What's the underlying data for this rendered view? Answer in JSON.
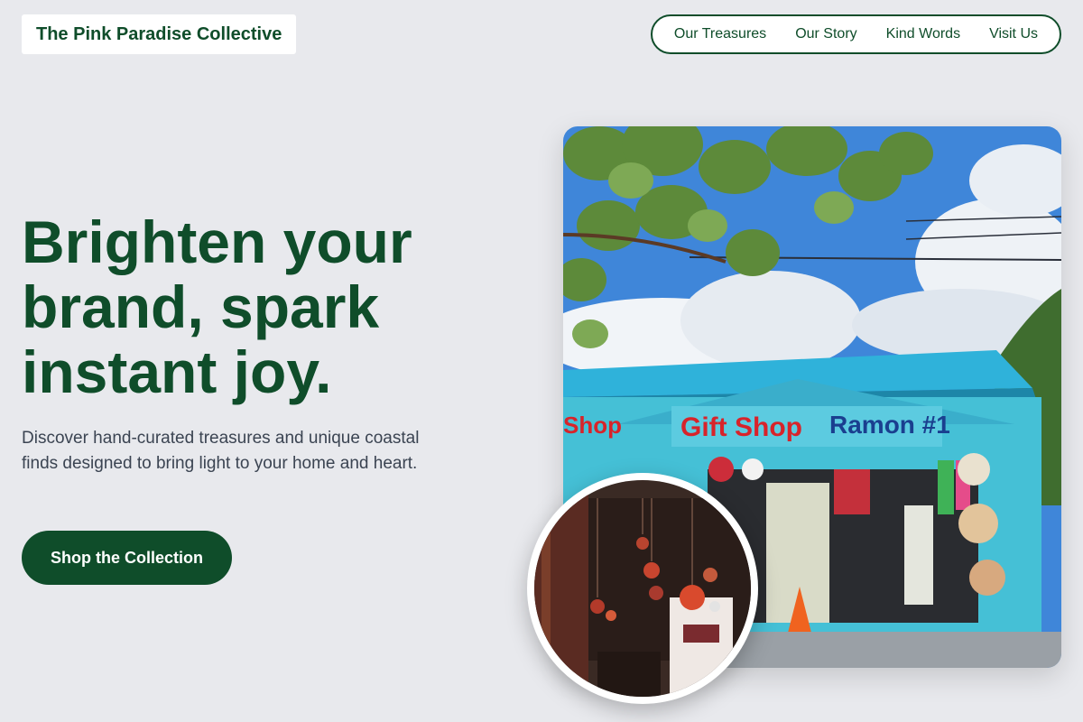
{
  "brand": {
    "name": "The Pink Paradise Collective"
  },
  "nav": {
    "items": [
      {
        "label": "Our Treasures"
      },
      {
        "label": "Our Story"
      },
      {
        "label": "Kind Words"
      },
      {
        "label": "Visit Us"
      }
    ]
  },
  "hero": {
    "headline": "Brighten your brand, spark instant joy.",
    "subtext": "Discover hand-curated treasures and unique coastal finds designed to bring light to your home and heart.",
    "cta_label": "Shop the Collection"
  },
  "images": {
    "main_alt": "Colorful gift shop storefront",
    "store_sign_left": "Shop",
    "store_sign_center": "Gift Shop",
    "store_sign_right": "Ramon #1",
    "inset_alt": "Shop window with hanging ornaments"
  },
  "colors": {
    "accent": "#0f4d2a",
    "background": "#e8e9ed",
    "body_text": "#3b4452"
  }
}
